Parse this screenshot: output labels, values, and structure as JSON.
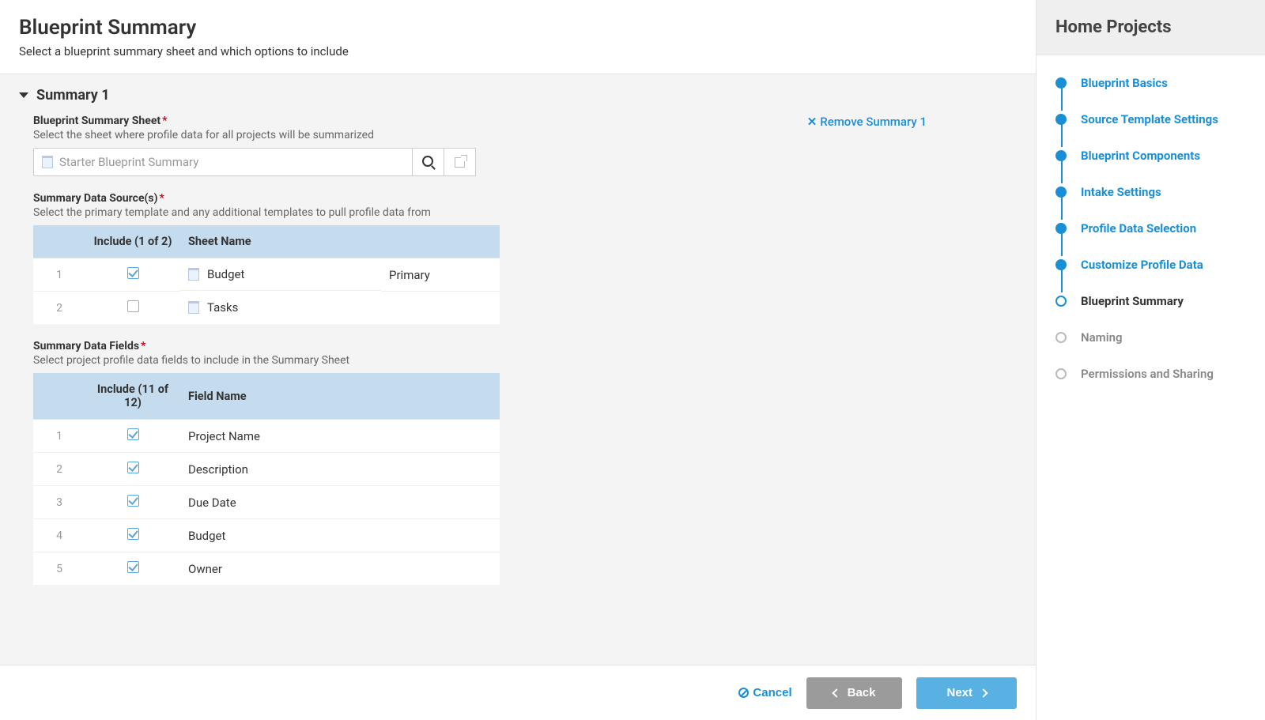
{
  "header": {
    "title": "Blueprint Summary",
    "subtitle": "Select a blueprint summary sheet and which options to include"
  },
  "summary": {
    "title": "Summary 1",
    "removeLabel": "Remove Summary 1",
    "sheet": {
      "label": "Blueprint Summary Sheet",
      "help": "Select the sheet where profile data for all projects will be summarized",
      "placeholder": "Starter Blueprint Summary"
    },
    "dataSource": {
      "label": "Summary Data Source(s)",
      "help": "Select the primary template and any additional templates to pull profile data from",
      "includeHeader": "Include (1 of 2)",
      "nameHeader": "Sheet Name",
      "rows": [
        {
          "n": "1",
          "checked": true,
          "name": "Budget",
          "tag": "Primary"
        },
        {
          "n": "2",
          "checked": false,
          "name": "Tasks",
          "tag": ""
        }
      ]
    },
    "dataFields": {
      "label": "Summary Data Fields",
      "help": "Select project profile data fields to include in the Summary Sheet",
      "includeHeader": "Include (11 of 12)",
      "nameHeader": "Field Name",
      "rows": [
        {
          "n": "1",
          "checked": true,
          "name": "Project Name"
        },
        {
          "n": "2",
          "checked": true,
          "name": "Description"
        },
        {
          "n": "3",
          "checked": true,
          "name": "Due Date"
        },
        {
          "n": "4",
          "checked": true,
          "name": "Budget"
        },
        {
          "n": "5",
          "checked": true,
          "name": "Owner"
        }
      ]
    }
  },
  "footer": {
    "cancel": "Cancel",
    "back": "Back",
    "next": "Next"
  },
  "sidebar": {
    "title": "Home Projects",
    "steps": [
      {
        "label": "Blueprint Basics",
        "state": "done"
      },
      {
        "label": "Source Template Settings",
        "state": "done"
      },
      {
        "label": "Blueprint Components",
        "state": "done"
      },
      {
        "label": "Intake Settings",
        "state": "done"
      },
      {
        "label": "Profile Data Selection",
        "state": "done"
      },
      {
        "label": "Customize Profile Data",
        "state": "done"
      },
      {
        "label": "Blueprint Summary",
        "state": "current"
      },
      {
        "label": "Naming",
        "state": "todo"
      },
      {
        "label": "Permissions and Sharing",
        "state": "todo"
      }
    ]
  }
}
